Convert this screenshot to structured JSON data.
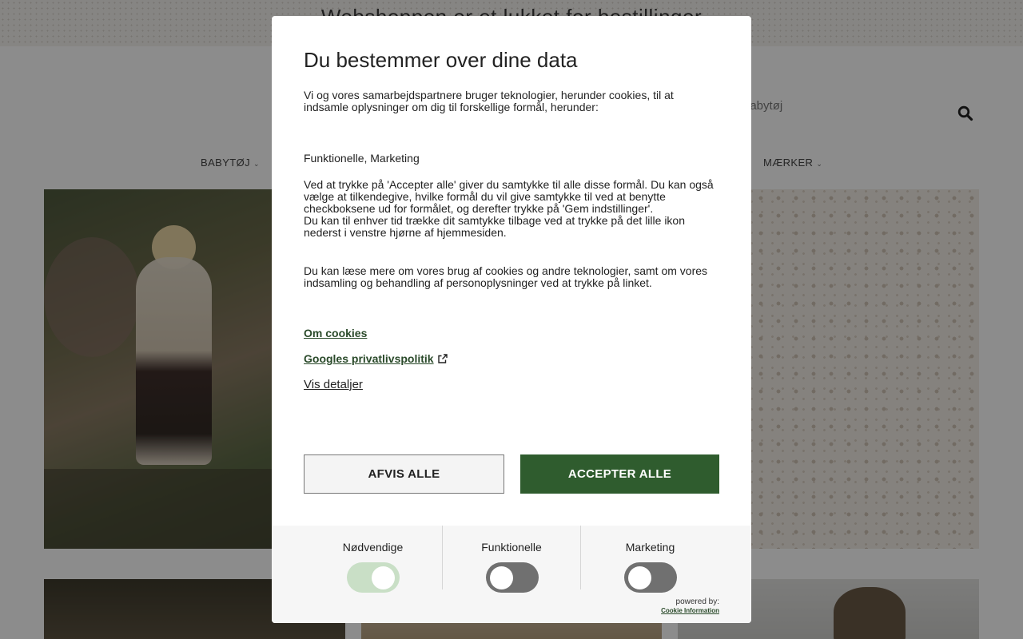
{
  "page": {
    "announcement": "Webshoppen er et lukket for bestillinger",
    "header_sub": "babytøj",
    "nav": [
      {
        "label": "BABYTØJ"
      },
      {
        "label": "MÆRKER"
      }
    ],
    "search_icon": "search-icon"
  },
  "modal": {
    "title": "Du bestemmer over dine data",
    "intro": "Vi og vores samarbejdspartnere bruger teknologier, herunder cookies, til at indsamle oplysninger om dig til forskellige formål, herunder:",
    "purposes": "Funktionelle, Marketing",
    "consent_1": "Ved at trykke på 'Accepter alle' giver du samtykke til alle disse formål. Du kan også vælge at tilkendegive, hvilke formål du vil give samtykke til ved at benytte checkboksene ud for formålet, og derefter trykke på 'Gem indstillinger'.",
    "consent_2": "Du kan til enhver tid trække dit samtykke tilbage ved at trykke på det lille ikon nederst i venstre hjørne af hjemmesiden.",
    "more_info": "Du kan læse mere om vores brug af cookies og andre teknologier, samt om vores indsamling og behandling af personoplysninger ved at trykke på linket.",
    "links": {
      "about_cookies": "Om cookies",
      "google_privacy": "Googles privatlivspolitik",
      "show_details": "Vis detaljer"
    },
    "buttons": {
      "reject": "AFVIS ALLE",
      "accept": "ACCEPTER ALLE"
    },
    "toggles": [
      {
        "label": "Nødvendige",
        "on": true,
        "locked": true
      },
      {
        "label": "Funktionelle",
        "on": false
      },
      {
        "label": "Marketing",
        "on": false
      }
    ],
    "powered_by": "powered by:",
    "brand": "Cookie Information",
    "colors": {
      "accent": "#2f5c2e",
      "toggle_on": "#c9dfc6",
      "toggle_off": "#707070"
    }
  }
}
